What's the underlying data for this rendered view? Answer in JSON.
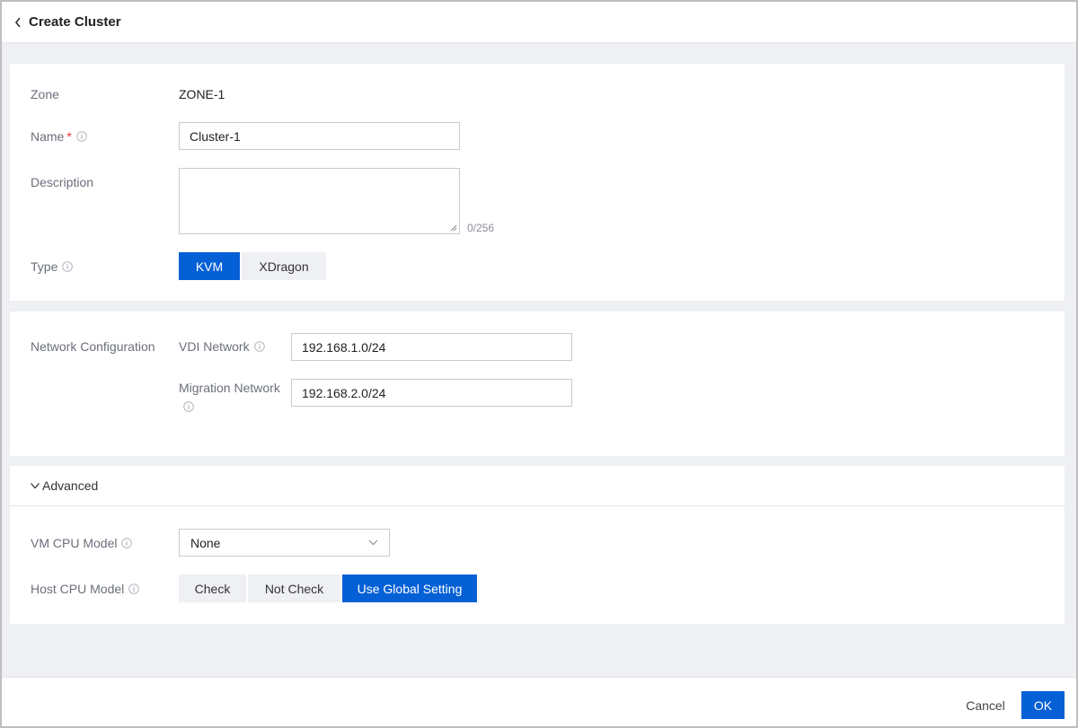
{
  "header": {
    "title": "Create Cluster"
  },
  "basic": {
    "zone_label": "Zone",
    "zone_value": "ZONE-1",
    "name_label": "Name",
    "name_required_mark": "*",
    "name_value": "Cluster-1",
    "description_label": "Description",
    "description_value": "",
    "description_counter": "0/256",
    "type_label": "Type",
    "type_options": [
      "KVM",
      "XDragon"
    ],
    "type_selected": "KVM"
  },
  "network": {
    "section_label": "Network Configuration",
    "vdi_label": "VDI Network",
    "vdi_value": "192.168.1.0/24",
    "migration_label": "Migration Network",
    "migration_value": "192.168.2.0/24"
  },
  "advanced": {
    "toggle_label": "Advanced",
    "vm_cpu_label": "VM CPU Model",
    "vm_cpu_value": "None",
    "host_cpu_label": "Host CPU Model",
    "host_cpu_options": [
      "Check",
      "Not Check",
      "Use Global Setting"
    ],
    "host_cpu_selected": "Use Global Setting"
  },
  "footer": {
    "cancel_label": "Cancel",
    "ok_label": "OK"
  },
  "colors": {
    "primary": "#0560d6",
    "required": "#e5383b",
    "page_bg": "#eff0f3"
  },
  "icons": {
    "back": "chevron-left-icon",
    "info": "info-icon",
    "expand": "chevron-down-icon",
    "select": "chevron-down-icon"
  }
}
